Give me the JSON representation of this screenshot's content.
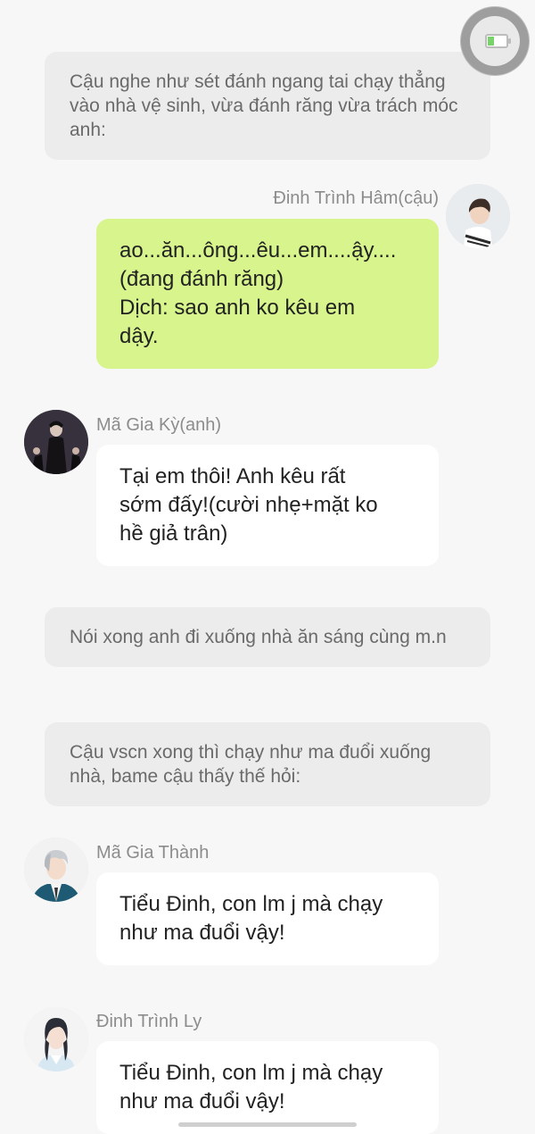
{
  "messages": [
    {
      "kind": "narration",
      "text": "Cậu nghe như sét đánh ngang tai chạy thẳng vào nhà vệ sinh, vừa đánh răng vừa trách móc anh:"
    },
    {
      "kind": "chat",
      "side": "right",
      "name": "Đinh Trình Hâm(cậu)",
      "lines": [
        "ao...ăn...ông...êu...em....ậy....",
        "(đang đánh răng)",
        "Dịch: sao anh ko kêu em",
        "dậy."
      ]
    },
    {
      "kind": "chat",
      "side": "left",
      "name": "Mã Gia Kỳ(anh)",
      "lines": [
        "Tại em thôi! Anh kêu rất",
        "sớm đấy!(cười nhẹ+mặt ko",
        "hề giả trân)"
      ]
    },
    {
      "kind": "narration",
      "text": "Nói xong anh đi xuống nhà ăn sáng cùng m.n"
    },
    {
      "kind": "narration",
      "text": "Cậu vscn xong thì chạy như ma đuổi xuống nhà, bame cậu thấy thế hỏi:"
    },
    {
      "kind": "chat",
      "side": "left",
      "name": "Mã Gia Thành",
      "lines": [
        "Tiểu Đinh, con lm j mà chạy",
        "như ma đuổi vậy!"
      ]
    },
    {
      "kind": "chat",
      "side": "left",
      "name": "Đinh Trình Ly",
      "lines": [
        "Tiểu Đinh, con lm j mà chạy",
        "như ma đuổi vậy!"
      ]
    }
  ],
  "colors": {
    "background": "#f7f7f7",
    "narration_bg": "#ececec",
    "bubble_self": "#d8f58d",
    "bubble_other": "#ffffff",
    "name_text": "#8c8c8c"
  },
  "icons": {
    "floating_button": "battery-charging-icon"
  }
}
